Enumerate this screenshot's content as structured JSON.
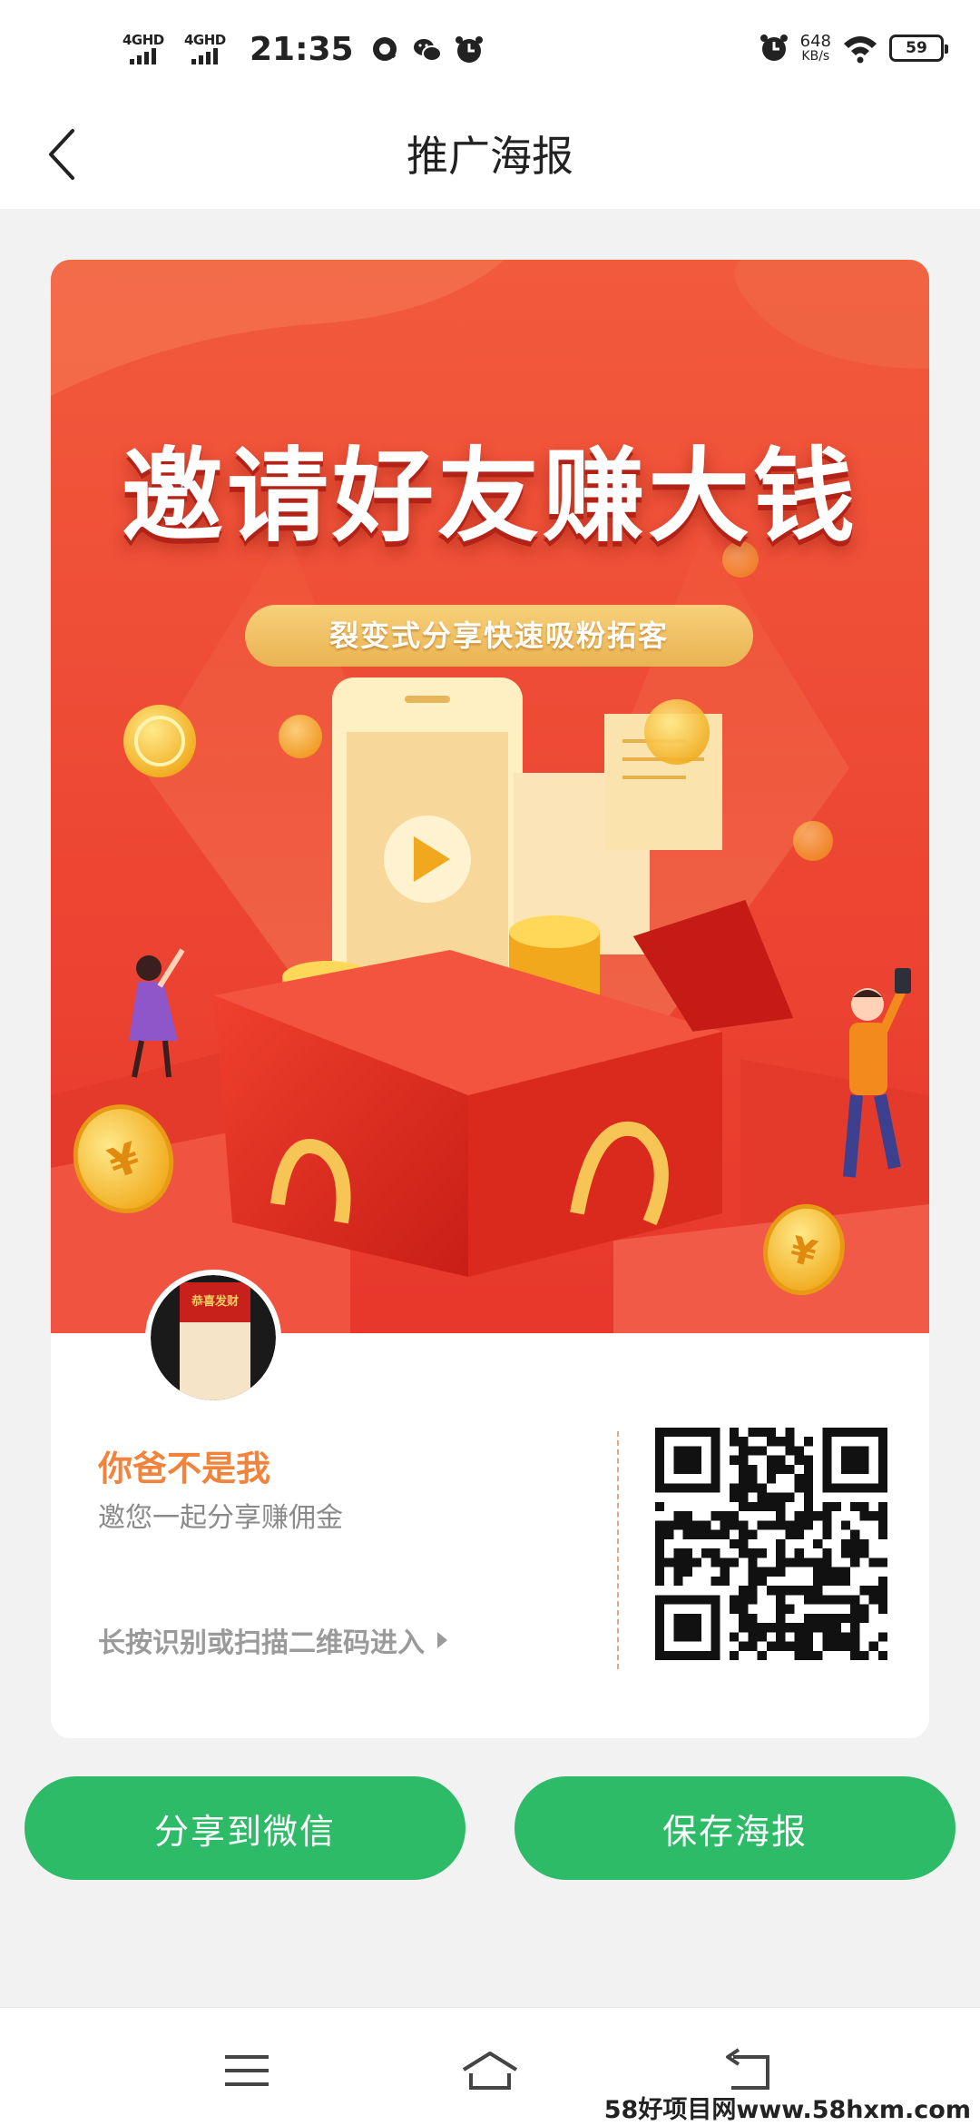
{
  "status_bar": {
    "net1": "4GHD",
    "net2": "4GHD",
    "time": "21:35",
    "speed_value": "648",
    "speed_unit": "KB/s",
    "battery": "59",
    "icons": [
      "q-icon",
      "wechat-icon",
      "clock-icon",
      "alarm-icon",
      "wifi-icon",
      "battery-icon"
    ]
  },
  "header": {
    "title": "推广海报",
    "back_icon": "chevron-left-icon"
  },
  "poster": {
    "headline": "邀请好友赚大钱",
    "tagline": "裂变式分享快速吸粉拓客",
    "avatar_text": "恭喜发财",
    "user_name": "你爸不是我",
    "invite_text": "邀您一起分享赚佣金",
    "scan_hint": "长按识别或扫描二维码进入",
    "colors": {
      "bg": "#f04a36",
      "gold": "#f5c343",
      "name": "#f0843c"
    }
  },
  "actions": {
    "share_label": "分享到微信",
    "save_label": "保存海报",
    "accent": "#2dbb68"
  },
  "nav": {
    "items": [
      "menu-icon",
      "home-icon",
      "back-icon"
    ]
  },
  "watermark": "58好项目网www.58hxm.com"
}
